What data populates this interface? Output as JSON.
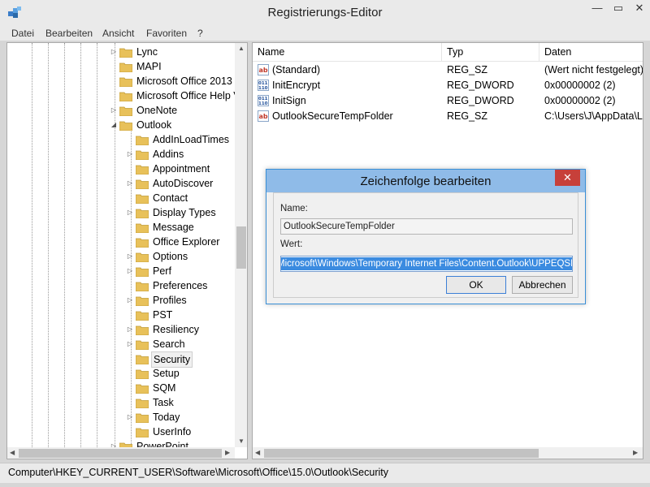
{
  "window": {
    "title": "Registrierungs-Editor",
    "minimize": "—",
    "maximize": "▭",
    "close": "✕"
  },
  "menu": [
    "Datei",
    "Bearbeiten",
    "Ansicht",
    "Favoriten",
    "?"
  ],
  "tree": {
    "items": [
      {
        "label": "Lync",
        "expandable": true,
        "depth": 1
      },
      {
        "label": "MAPI",
        "expandable": false,
        "depth": 1
      },
      {
        "label": "Microsoft Office 2013",
        "expandable": false,
        "depth": 1
      },
      {
        "label": "Microsoft Office Help V",
        "expandable": false,
        "depth": 1
      },
      {
        "label": "OneNote",
        "expandable": true,
        "depth": 1
      },
      {
        "label": "Outlook",
        "expandable": true,
        "expanded": true,
        "depth": 1
      },
      {
        "label": "AddInLoadTimes",
        "expandable": false,
        "depth": 2
      },
      {
        "label": "Addins",
        "expandable": true,
        "depth": 2
      },
      {
        "label": "Appointment",
        "expandable": false,
        "depth": 2
      },
      {
        "label": "AutoDiscover",
        "expandable": true,
        "depth": 2
      },
      {
        "label": "Contact",
        "expandable": false,
        "depth": 2
      },
      {
        "label": "Display Types",
        "expandable": true,
        "depth": 2
      },
      {
        "label": "Message",
        "expandable": false,
        "depth": 2
      },
      {
        "label": "Office Explorer",
        "expandable": false,
        "depth": 2
      },
      {
        "label": "Options",
        "expandable": true,
        "depth": 2
      },
      {
        "label": "Perf",
        "expandable": true,
        "depth": 2
      },
      {
        "label": "Preferences",
        "expandable": false,
        "depth": 2
      },
      {
        "label": "Profiles",
        "expandable": true,
        "depth": 2
      },
      {
        "label": "PST",
        "expandable": false,
        "depth": 2
      },
      {
        "label": "Resiliency",
        "expandable": true,
        "depth": 2
      },
      {
        "label": "Search",
        "expandable": true,
        "depth": 2
      },
      {
        "label": "Security",
        "expandable": false,
        "depth": 2,
        "selected": true
      },
      {
        "label": "Setup",
        "expandable": false,
        "depth": 2
      },
      {
        "label": "SQM",
        "expandable": false,
        "depth": 2
      },
      {
        "label": "Task",
        "expandable": false,
        "depth": 2
      },
      {
        "label": "Today",
        "expandable": true,
        "depth": 2
      },
      {
        "label": "UserInfo",
        "expandable": false,
        "depth": 2
      },
      {
        "label": "PowerPoint",
        "expandable": true,
        "depth": 1
      }
    ]
  },
  "list": {
    "columns": [
      "Name",
      "Typ",
      "Daten"
    ],
    "rows": [
      {
        "icon": "string-value-icon",
        "name": "(Standard)",
        "type": "REG_SZ",
        "data": "(Wert nicht festgelegt)"
      },
      {
        "icon": "dword-value-icon",
        "name": "InitEncrypt",
        "type": "REG_DWORD",
        "data": "0x00000002 (2)"
      },
      {
        "icon": "dword-value-icon",
        "name": "InitSign",
        "type": "REG_DWORD",
        "data": "0x00000002 (2)"
      },
      {
        "icon": "string-value-icon",
        "name": "OutlookSecureTempFolder",
        "type": "REG_SZ",
        "data": "C:\\Users\\J\\AppData\\Lo"
      }
    ]
  },
  "status": {
    "path": "Computer\\HKEY_CURRENT_USER\\Software\\Microsoft\\Office\\15.0\\Outlook\\Security"
  },
  "dialog": {
    "title": "Zeichenfolge bearbeiten",
    "close": "✕",
    "name_label": "Name:",
    "name_value": "OutlookSecureTempFolder",
    "value_label": "Wert:",
    "value_text": "Microsoft\\Windows\\Temporary Internet Files\\Content.Outlook\\UPPEQSLL\\",
    "ok_label": "OK",
    "cancel_label": "Abbrechen"
  },
  "colors": {
    "folder": "#e8c15a",
    "selection": "#3b8be0",
    "dialog_title": "#8fbbe8",
    "close_red": "#c7403a"
  }
}
